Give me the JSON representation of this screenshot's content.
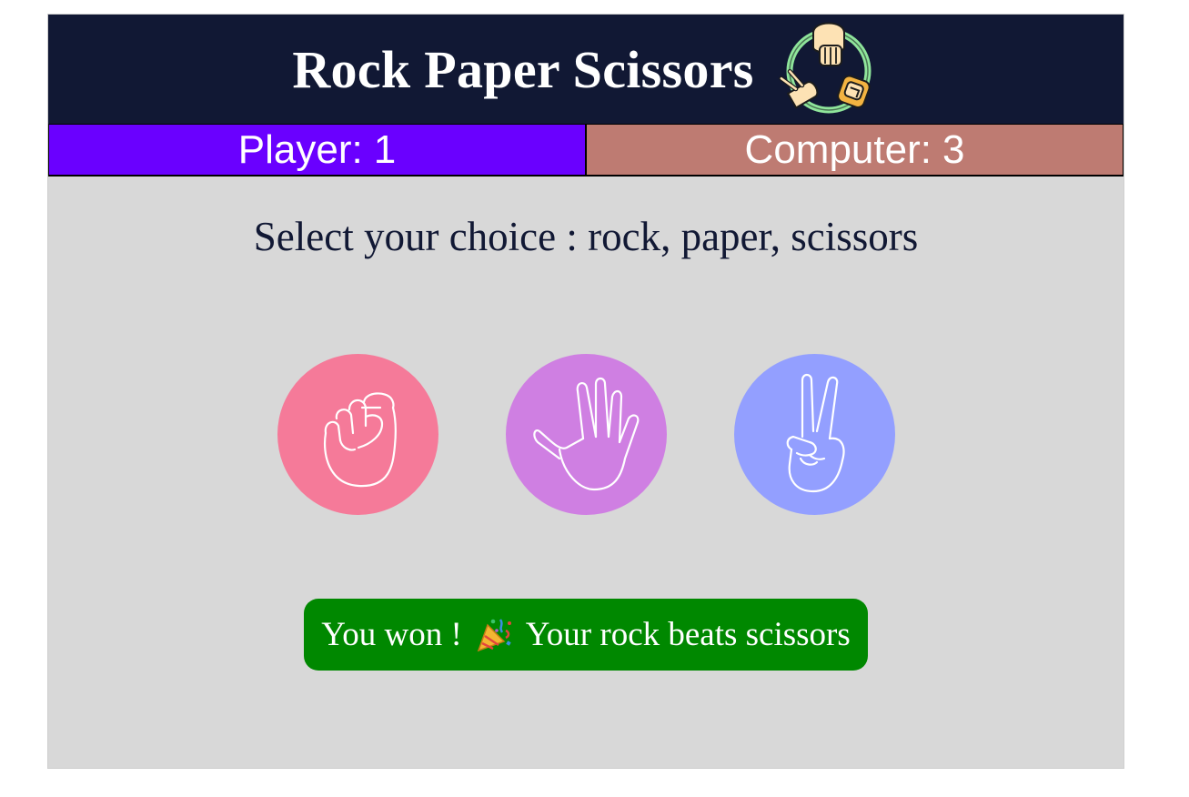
{
  "header": {
    "title": "Rock Paper Scissors",
    "logo_icon": "rock-paper-scissors-cycle-icon"
  },
  "scoreboard": {
    "player_label": "Player:",
    "player_score": "1",
    "player_color": "#6a00ff",
    "computer_label": "Computer:",
    "computer_score": "3",
    "computer_color": "#be7b72"
  },
  "prompt": "Select your choice : rock, paper, scissors",
  "choices": [
    {
      "id": "rock",
      "icon": "fist-icon",
      "color": "#f57a99"
    },
    {
      "id": "paper",
      "icon": "open-hand-icon",
      "color": "#cf7fe2"
    },
    {
      "id": "scissors",
      "icon": "peace-hand-icon",
      "color": "#939fff"
    }
  ],
  "result": {
    "prefix": "You won !",
    "emoji_icon": "party-popper-icon",
    "message": "Your rock beats scissors",
    "color": "#008800"
  },
  "colors": {
    "header_bg": "#111834",
    "body_bg": "#d8d8d8"
  }
}
